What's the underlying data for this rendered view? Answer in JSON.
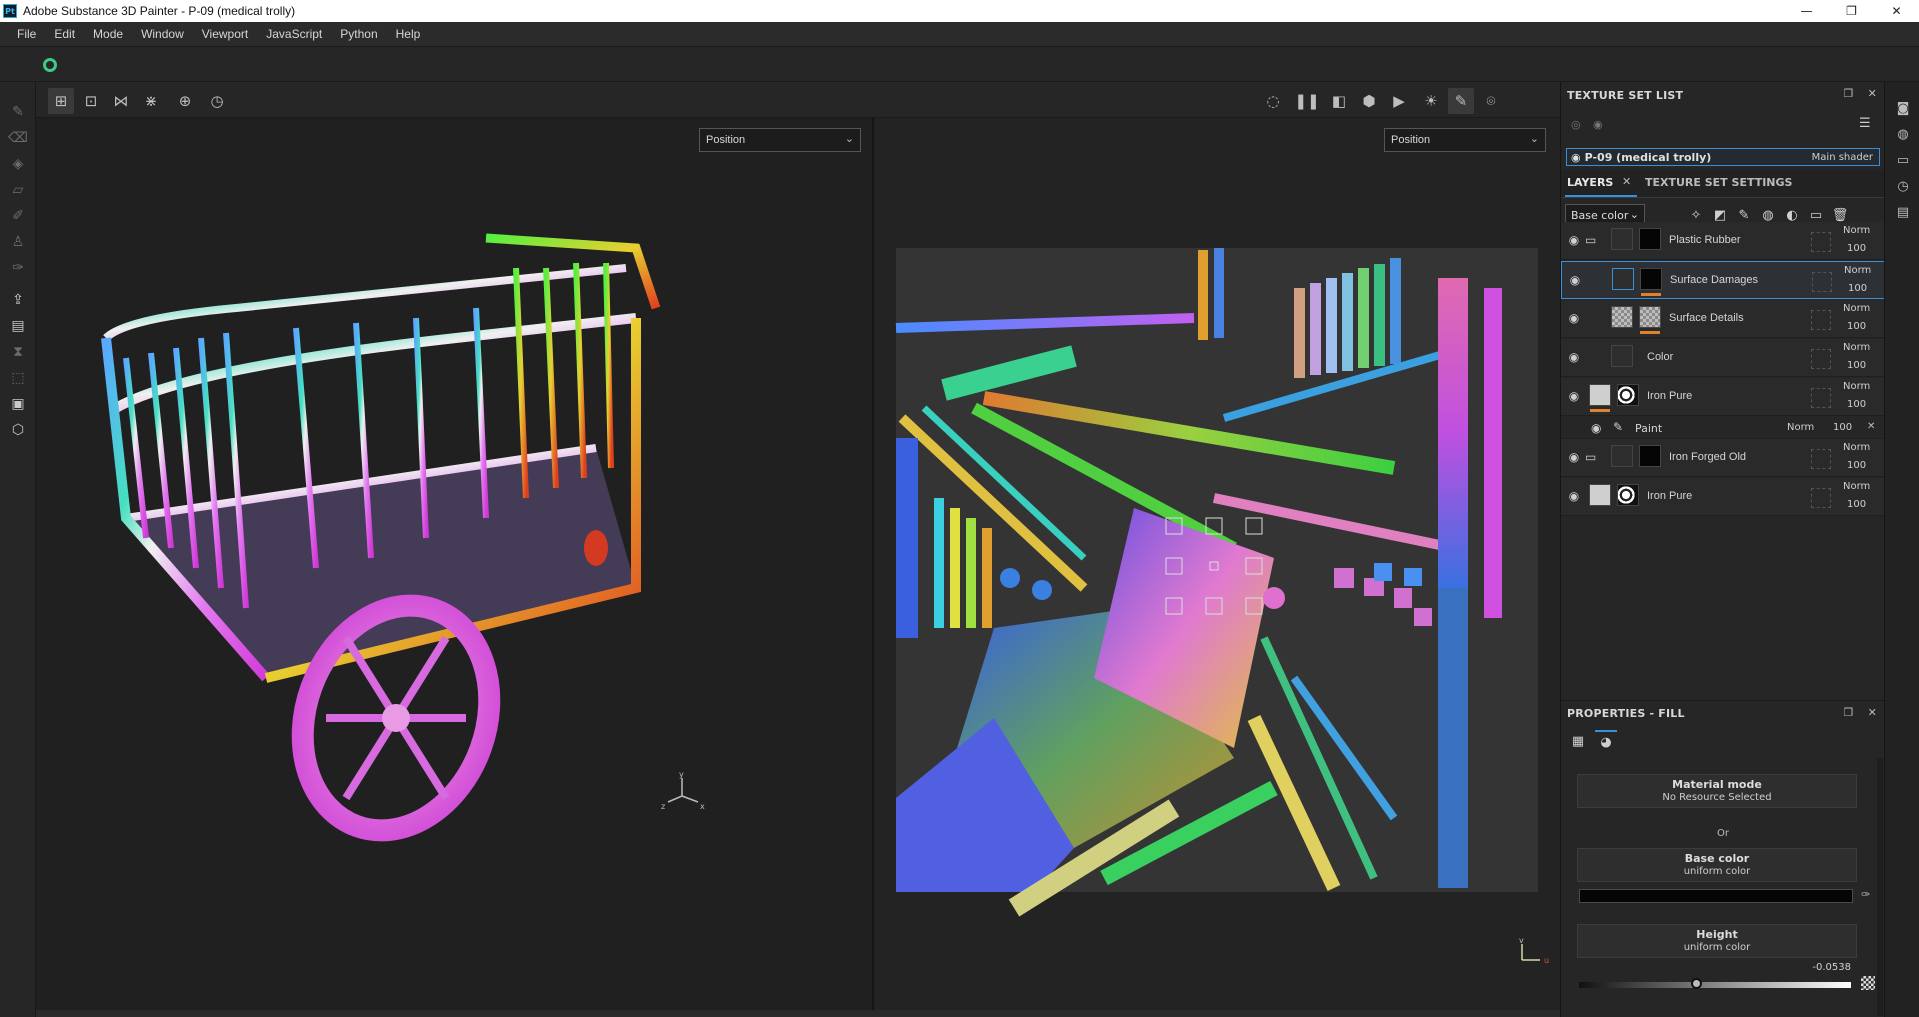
{
  "window": {
    "logo": "Pt",
    "title": "Adobe Substance 3D Painter - P-09 (medical trolly)",
    "controls": {
      "minimize": "—",
      "maximize": "❐",
      "close": "✕"
    }
  },
  "menu": [
    "File",
    "Edit",
    "Mode",
    "Window",
    "Viewport",
    "JavaScript",
    "Python",
    "Help"
  ],
  "viewport": {
    "left_channel": "Position",
    "right_channel": "Position",
    "gizmo_left": {
      "x": "x",
      "y": "y",
      "z": "z"
    },
    "gizmo_right": {
      "u": "u",
      "v": "v"
    }
  },
  "texture_set_list": {
    "title": "TEXTURE SET LIST",
    "item_name": "P-09 (medical trolly)",
    "item_shader": "Main shader"
  },
  "tabs": {
    "layers": "LAYERS",
    "texture_set_settings": "TEXTURE SET SETTINGS"
  },
  "channel_select": "Base color",
  "layers": [
    {
      "name": "Plastic Rubber",
      "blend": "Norm",
      "opacity": "100"
    },
    {
      "name": "Surface Damages",
      "blend": "Norm",
      "opacity": "100"
    },
    {
      "name": "Surface Details",
      "blend": "Norm",
      "opacity": "100"
    },
    {
      "name": "Color",
      "blend": "Norm",
      "opacity": "100"
    },
    {
      "name": "Iron Pure",
      "blend": "Norm",
      "opacity": "100"
    },
    {
      "name": "Paint",
      "blend": "Norm",
      "opacity": "100"
    },
    {
      "name": "Iron Forged Old",
      "blend": "Norm",
      "opacity": "100"
    },
    {
      "name": "Iron Pure",
      "blend": "Norm",
      "opacity": "100"
    }
  ],
  "properties": {
    "title": "PROPERTIES - FILL",
    "material_mode": "Material mode",
    "no_resource": "No Resource Selected",
    "or": "Or",
    "base_color": "Base color",
    "base_color_sub": "uniform color",
    "height": "Height",
    "height_sub": "uniform color",
    "height_value": "-0.0538"
  }
}
